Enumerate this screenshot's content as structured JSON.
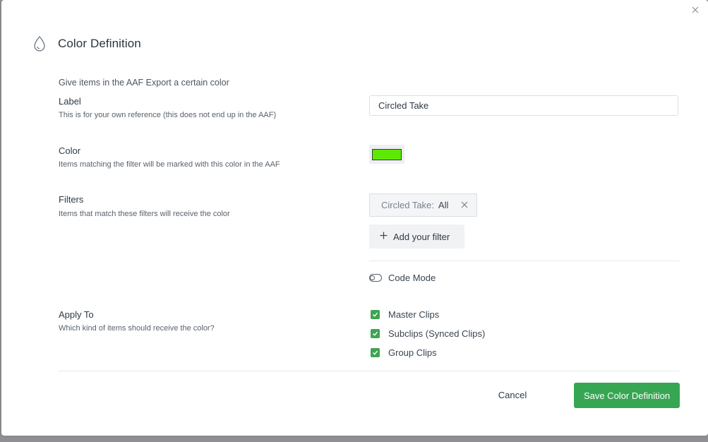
{
  "dialog": {
    "title": "Color Definition",
    "intro": "Give items in the AAF Export a certain color",
    "close_icon": "close-icon"
  },
  "label_section": {
    "label": "Label",
    "description": "This is for your own reference (this does not end up in the AAF)",
    "value": "Circled Take",
    "placeholder": ""
  },
  "color_section": {
    "label": "Color",
    "description": "Items matching the filter will be marked with this color in the AAF",
    "selected_color": "#5ee806"
  },
  "filters_section": {
    "label": "Filters",
    "description": "Items that match these filters will receive the color",
    "filters": [
      {
        "key": "Circled Take:",
        "value": "All"
      }
    ],
    "add_filter_label": "Add your filter",
    "code_mode_label": "Code Mode"
  },
  "apply_section": {
    "label": "Apply To",
    "description": "Which kind of items should receive the color?",
    "options": [
      {
        "label": "Master Clips",
        "checked": true
      },
      {
        "label": "Subclips (Synced Clips)",
        "checked": true
      },
      {
        "label": "Group Clips",
        "checked": true
      }
    ]
  },
  "footer": {
    "cancel_label": "Cancel",
    "save_label": "Save Color Definition"
  },
  "colors": {
    "accent": "#37a653",
    "checkbox": "#3fa451",
    "swatch": "#5ee806"
  }
}
